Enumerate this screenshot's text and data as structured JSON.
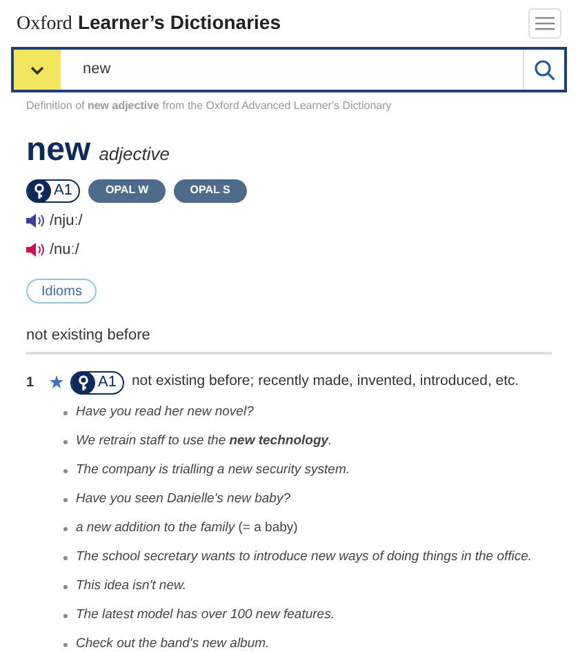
{
  "header": {
    "logo_light": "Oxford",
    "logo_bold": "Learner’s Dictionaries"
  },
  "search": {
    "value": "new"
  },
  "source_note": "Definition of **new adjective** from the Oxford Advanced Learner's Dictionary",
  "entry": {
    "headword": "new",
    "pos": "adjective",
    "level": "A1",
    "labels": [
      "OPAL W",
      "OPAL S"
    ],
    "pronunciations": [
      {
        "text": "/njuː/",
        "color": "#3b3fa0"
      },
      {
        "text": "/nuː/",
        "color": "#d0104c"
      }
    ],
    "idioms_button": "Idioms",
    "shortcut": "not existing before",
    "senses": [
      {
        "number": "1",
        "starred": true,
        "level": "A1",
        "definition": "not existing before; recently made, invented, introduced, etc.",
        "examples": [
          {
            "text": "Have you read her new novel?"
          },
          {
            "text": "We retrain staff to use the **new technology**."
          },
          {
            "text": "The company is trialling a new security system."
          },
          {
            "text": "Have you seen Danielle's new baby?"
          },
          {
            "text": "a new addition to the family",
            "gloss": "(= a baby)"
          },
          {
            "text": "The school secretary wants to introduce new ways of doing things in the office."
          },
          {
            "text": "This idea isn't new."
          },
          {
            "text": "The latest model has over 100 new features."
          },
          {
            "text": "Check out the band's new album."
          }
        ]
      }
    ]
  }
}
